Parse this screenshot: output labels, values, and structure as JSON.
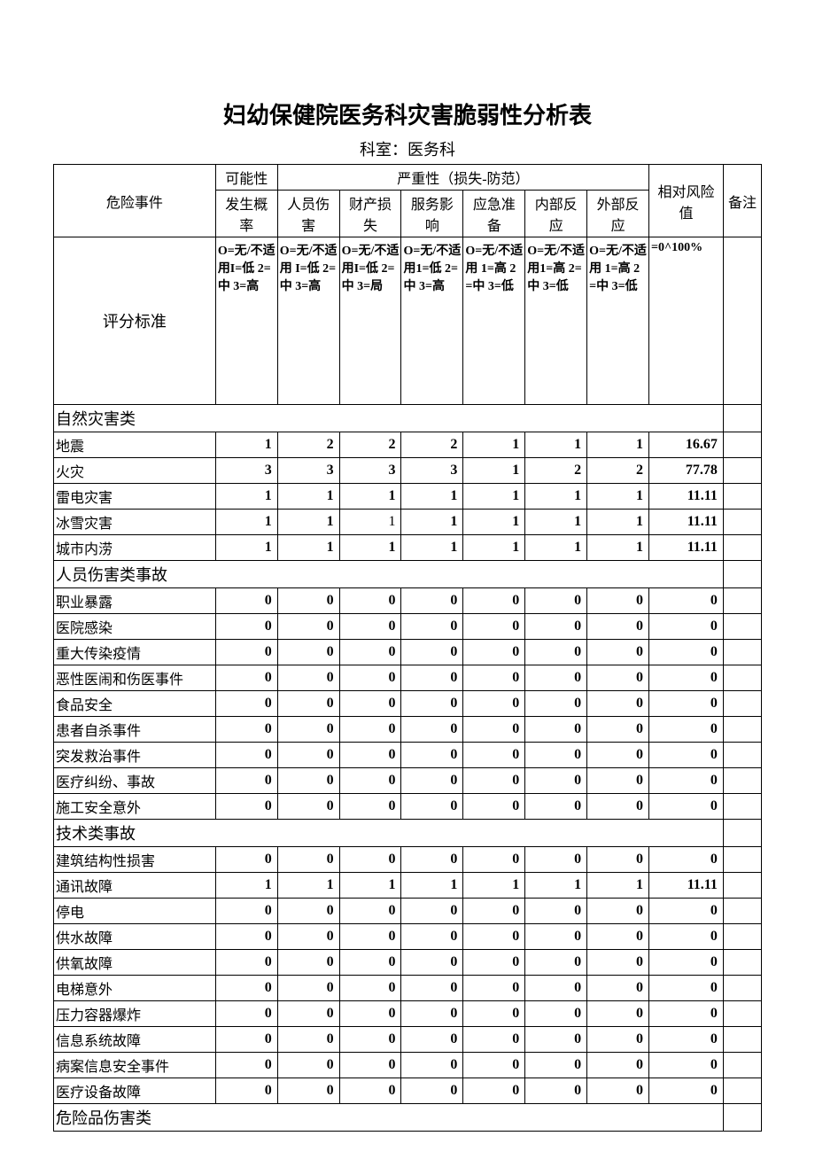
{
  "title": "妇幼保健院医务科灾害脆弱性分析表",
  "dept_label": "科室：医务科",
  "headers": {
    "event": "危险事件",
    "possibility": "可能性",
    "severity": "严重性（损失-防范）",
    "probability": "发生概率",
    "injury": "人员伤害",
    "property": "财产损失",
    "service": "服务影响",
    "emergency": "应急准备",
    "internal": "内部反应",
    "external": "外部反应",
    "risk": "相对风险值",
    "note": "备注"
  },
  "criteria": {
    "label": "评分标准",
    "probability": "O=无/不适用I=低 2=中 3=高",
    "injury": "O=无/不适用 I=低 2=中 3=高",
    "property": "O=无/不适用I=低 2=中 3=局",
    "service": "O=无/不适用1=低 2=中 3=高",
    "emergency": "O=无/不适用 1=高 2 =中 3=低",
    "internal": "O=无/不适用1=高 2=中 3=低",
    "external": "O=无/不适用 1=高 2 =中 3=低",
    "risk": "=0^100%"
  },
  "sections": [
    {
      "name": "自然灾害类",
      "rows": [
        {
          "label": "地震",
          "v": [
            "1",
            "2",
            "2",
            "2",
            "1",
            "1",
            "1",
            "16.67",
            ""
          ]
        },
        {
          "label": "火灾",
          "v": [
            "3",
            "3",
            "3",
            "3",
            "1",
            "2",
            "2",
            "77.78",
            ""
          ]
        },
        {
          "label": "雷电灾害",
          "v": [
            "1",
            "1",
            "1",
            "1",
            "1",
            "1",
            "1",
            "11.11",
            ""
          ]
        },
        {
          "label": "冰雪灾害",
          "v": [
            "1",
            "1",
            "1",
            "1",
            "1",
            "1",
            "1",
            "11.11",
            ""
          ],
          "normalIdx": 2
        },
        {
          "label": "城市内涝",
          "v": [
            "1",
            "1",
            "1",
            "1",
            "1",
            "1",
            "1",
            "11.11",
            ""
          ]
        }
      ]
    },
    {
      "name": "人员伤害类事故",
      "rows": [
        {
          "label": "职业暴露",
          "v": [
            "0",
            "0",
            "0",
            "0",
            "0",
            "0",
            "0",
            "0",
            ""
          ]
        },
        {
          "label": "医院感染",
          "v": [
            "0",
            "0",
            "0",
            "0",
            "0",
            "0",
            "0",
            "0",
            ""
          ]
        },
        {
          "label": "重大传染疫情",
          "v": [
            "0",
            "0",
            "0",
            "0",
            "0",
            "0",
            "0",
            "0",
            ""
          ]
        },
        {
          "label": "恶性医闹和伤医事件",
          "v": [
            "0",
            "0",
            "0",
            "0",
            "0",
            "0",
            "0",
            "0",
            ""
          ]
        },
        {
          "label": "食品安全",
          "v": [
            "0",
            "0",
            "0",
            "0",
            "0",
            "0",
            "0",
            "0",
            ""
          ]
        },
        {
          "label": "患者自杀事件",
          "v": [
            "0",
            "0",
            "0",
            "0",
            "0",
            "0",
            "0",
            "0",
            ""
          ]
        },
        {
          "label": "突发救治事件",
          "v": [
            "0",
            "0",
            "0",
            "0",
            "0",
            "0",
            "0",
            "0",
            ""
          ]
        },
        {
          "label": "医疗纠纷、事故",
          "v": [
            "0",
            "0",
            "0",
            "0",
            "0",
            "0",
            "0",
            "0",
            ""
          ]
        },
        {
          "label": "施工安全意外",
          "v": [
            "0",
            "0",
            "0",
            "0",
            "0",
            "0",
            "0",
            "0",
            ""
          ]
        }
      ]
    },
    {
      "name": "技术类事故",
      "rows": [
        {
          "label": "建筑结构性损害",
          "v": [
            "0",
            "0",
            "0",
            "0",
            "0",
            "0",
            "0",
            "0",
            ""
          ]
        },
        {
          "label": "通讯故障",
          "v": [
            "1",
            "1",
            "1",
            "1",
            "1",
            "1",
            "1",
            "11.11",
            ""
          ]
        },
        {
          "label": "停电",
          "v": [
            "0",
            "0",
            "0",
            "0",
            "0",
            "0",
            "0",
            "0",
            ""
          ]
        },
        {
          "label": "供水故障",
          "v": [
            "0",
            "0",
            "0",
            "0",
            "0",
            "0",
            "0",
            "0",
            ""
          ]
        },
        {
          "label": "供氧故障",
          "v": [
            "0",
            "0",
            "0",
            "0",
            "0",
            "0",
            "0",
            "0",
            ""
          ]
        },
        {
          "label": "电梯意外",
          "v": [
            "0",
            "0",
            "0",
            "0",
            "0",
            "0",
            "0",
            "0",
            ""
          ]
        },
        {
          "label": "压力容器爆炸",
          "v": [
            "0",
            "0",
            "0",
            "0",
            "0",
            "0",
            "0",
            "0",
            ""
          ]
        },
        {
          "label": "信息系统故障",
          "v": [
            "0",
            "0",
            "0",
            "0",
            "0",
            "0",
            "0",
            "0",
            ""
          ]
        },
        {
          "label": "病案信息安全事件",
          "v": [
            "0",
            "0",
            "0",
            "0",
            "0",
            "0",
            "0",
            "0",
            ""
          ]
        },
        {
          "label": "医疗设备故障",
          "v": [
            "0",
            "0",
            "0",
            "0",
            "0",
            "0",
            "0",
            "0",
            ""
          ]
        }
      ]
    },
    {
      "name": "危险品伤害类",
      "rows": []
    }
  ]
}
